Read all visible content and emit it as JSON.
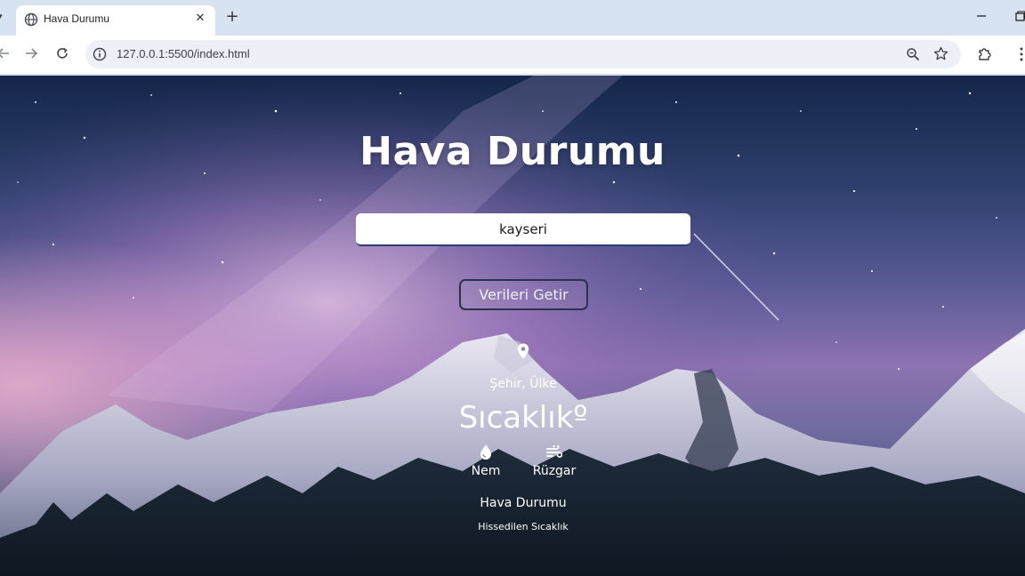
{
  "browser": {
    "tab_title": "Hava Durumu",
    "url": "127.0.0.1:5500/index.html"
  },
  "page": {
    "title": "Hava Durumu",
    "search": {
      "value": "kayseri"
    },
    "button_label": "Verileri Getir",
    "city_country": "Şehir, Ülke",
    "temperature": "Sıcaklıkº",
    "humidity_label": "Nem",
    "wind_label": "Rüzgar",
    "weather_description": "Hava Durumu",
    "feels_like": "Hissedilen Sıcaklık"
  },
  "icons": {
    "tab_favicon": "globe-icon",
    "location": "map-pin-icon",
    "humidity": "water-drop-icon",
    "wind": "wind-icon"
  },
  "colors": {
    "tab_strip": "#d8e3f2",
    "button_border": "#2b3250",
    "input_underline": "#2c3c78",
    "text": "#ffffff"
  }
}
